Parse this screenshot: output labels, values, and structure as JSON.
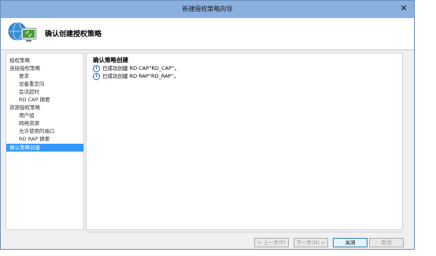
{
  "window": {
    "title": "新建授权策略向导",
    "close_glyph": "✕"
  },
  "header": {
    "title": "确认创建授权策略",
    "icon": "network-wizard-icon"
  },
  "sidebar": {
    "items": [
      {
        "label": "授权策略",
        "level": 0
      },
      {
        "label": "连接授权策略",
        "level": 0
      },
      {
        "label": "要求",
        "level": 1
      },
      {
        "label": "设备重定向",
        "level": 1
      },
      {
        "label": "会话超时",
        "level": 1
      },
      {
        "label": "RD CAP 摘要",
        "level": 1
      },
      {
        "label": "资源授权策略",
        "level": 0
      },
      {
        "label": "用户组",
        "level": 1
      },
      {
        "label": "网络资源",
        "level": 1
      },
      {
        "label": "允许使用的端口",
        "level": 1
      },
      {
        "label": "RD RAP 摘要",
        "level": 1
      },
      {
        "label": "确认策略创建",
        "level": 0,
        "selected": true
      }
    ]
  },
  "main": {
    "title": "确认策略创建",
    "results": [
      {
        "icon": "info-icon",
        "text": "已成功创建 RD CAP“RD_CAP”。"
      },
      {
        "icon": "info-icon",
        "text": "已成功创建 RD RAP“RD_RAP”。"
      }
    ]
  },
  "buttons": {
    "prev": "< 上一步(P)",
    "next": "下一步(N) >",
    "close": "关闭",
    "cancel": "取消"
  },
  "colors": {
    "titlebar": "#8ab0e0",
    "selected": "#3399ff"
  }
}
